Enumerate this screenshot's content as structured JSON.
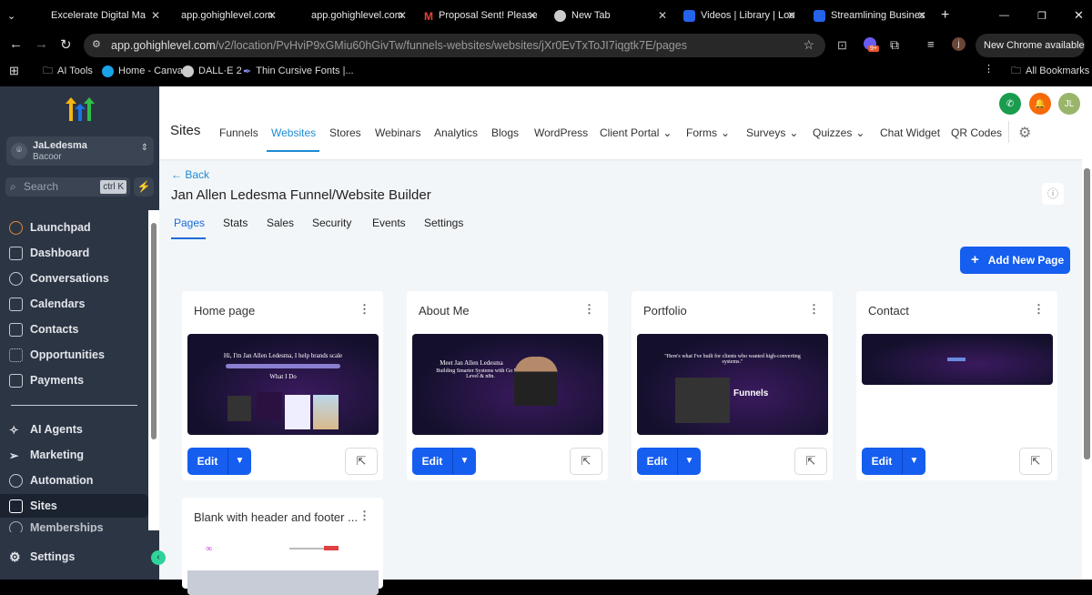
{
  "browser": {
    "tabs": [
      {
        "label": "Excelerate Digital Ma",
        "icon": "none"
      },
      {
        "label": "app.gohighlevel.com",
        "icon": "none"
      },
      {
        "label": "app.gohighlevel.com",
        "icon": "none"
      },
      {
        "label": "Proposal Sent! Please",
        "icon": "gmail-icon"
      },
      {
        "label": "New Tab",
        "icon": "chrome-icon"
      },
      {
        "label": "Videos | Library | Loo",
        "icon": "gear-icon"
      },
      {
        "label": "Streamlining Busines",
        "icon": "gear-icon"
      }
    ],
    "url_host": "app.gohighlevel.com",
    "url_path": "/v2/location/PvHviP9xGMiu60hGivTw/funnels-websites/websites/jXr0EvTxToJI7iqgtk7E/pages",
    "extension_badge": "9+",
    "profile_initial": "j",
    "update_label": "New Chrome available",
    "bookmarks": [
      "AI Tools",
      "Home - Canva",
      "DALL·E 2",
      "Thin Cursive Fonts |..."
    ],
    "all_bookmarks": "All Bookmarks"
  },
  "sidebar": {
    "account_name": "JaLedesma",
    "account_location": "Bacoor",
    "search_placeholder": "Search",
    "search_shortcut": "ctrl K",
    "items": [
      "Launchpad",
      "Dashboard",
      "Conversations",
      "Calendars",
      "Contacts",
      "Opportunities",
      "Payments"
    ],
    "items2": [
      "AI Agents",
      "Marketing",
      "Automation",
      "Sites",
      "Memberships"
    ],
    "settings": "Settings",
    "active": "Sites"
  },
  "header": {
    "section": "Sites",
    "nav": [
      "Funnels",
      "Websites",
      "Stores",
      "Webinars",
      "Analytics",
      "Blogs",
      "WordPress",
      "Client Portal",
      "Forms",
      "Surveys",
      "Quizzes",
      "Chat Widget",
      "QR Codes"
    ],
    "active": "Websites",
    "avatar_initials": "JL",
    "colors": {
      "phone": "#1a9c4e",
      "bell": "#f66a0a",
      "avatar": "#98b56a"
    }
  },
  "page": {
    "back": "← Back",
    "title": "Jan Allen Ledesma Funnel/Website Builder",
    "tabs": [
      "Pages",
      "Stats",
      "Sales",
      "Security",
      "Events",
      "Settings"
    ],
    "active_tab": "Pages",
    "add_button": "Add New Page",
    "edit_label": "Edit",
    "cards": [
      {
        "title": "Home page",
        "thumb_heading": "Hi, I'm Jan Allen Ledesma, I help brands scale",
        "thumb_sub": "What I Do"
      },
      {
        "title": "About Me",
        "thumb_heading": "Meet Jan Allen Ledesma",
        "thumb_sub": "Building Smarter Systems with Go High Level & n8n."
      },
      {
        "title": "Portfolio",
        "thumb_heading": "\"Here's what I've built for clients who wanted high-converting systems.\"",
        "thumb_sub": "Funnels"
      },
      {
        "title": "Contact",
        "thumb_heading": "",
        "thumb_sub": ""
      },
      {
        "title": "Blank with header and footer ...",
        "thumb_heading": "",
        "thumb_sub": ""
      }
    ]
  },
  "accent": "#155eef"
}
